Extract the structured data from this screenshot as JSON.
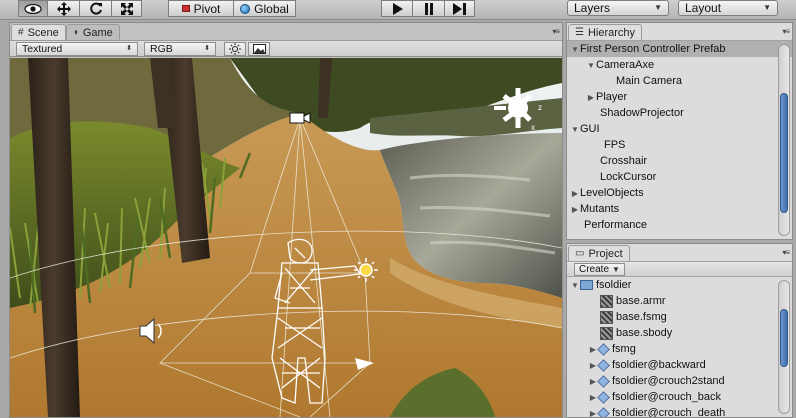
{
  "toolbar": {
    "tools": [
      "view-tool",
      "move-tool",
      "rotate-tool",
      "scale-tool"
    ],
    "pivot_label": "Pivot",
    "global_label": "Global",
    "play_controls": [
      "play",
      "pause",
      "step"
    ],
    "layers_label": "Layers",
    "layout_label": "Layout"
  },
  "scene_panel": {
    "tabs": [
      {
        "label": "Scene",
        "icon": "hash-icon"
      },
      {
        "label": "Game",
        "icon": "pacman-icon"
      }
    ],
    "render_mode": "Textured",
    "color_mode": "RGB"
  },
  "hierarchy": {
    "title": "Hierarchy",
    "items": [
      {
        "label": "First Person Controller Prefab",
        "level": 0,
        "expanded": true,
        "selected": true
      },
      {
        "label": "CameraAxe",
        "level": 1,
        "expanded": true
      },
      {
        "label": "Main Camera",
        "level": 2
      },
      {
        "label": "Player",
        "level": 1,
        "expanded": false
      },
      {
        "label": "ShadowProjector",
        "level": 1
      },
      {
        "label": "GUI",
        "level": 0,
        "expanded": true
      },
      {
        "label": "FPS",
        "level": 1
      },
      {
        "label": "Crosshair",
        "level": 1
      },
      {
        "label": "LockCursor",
        "level": 1
      },
      {
        "label": "LevelObjects",
        "level": 0,
        "expanded": false
      },
      {
        "label": "Mutants",
        "level": 0,
        "expanded": false
      },
      {
        "label": "Performance",
        "level": 0
      }
    ]
  },
  "project": {
    "title": "Project",
    "create_label": "Create",
    "items": [
      {
        "label": "fsoldier",
        "level": 0,
        "type": "folder",
        "expanded": true
      },
      {
        "label": "base.armr",
        "level": 1,
        "type": "mesh"
      },
      {
        "label": "base.fsmg",
        "level": 1,
        "type": "mesh"
      },
      {
        "label": "base.sbody",
        "level": 1,
        "type": "mesh"
      },
      {
        "label": "fsmg",
        "level": 1,
        "type": "prefab"
      },
      {
        "label": "fsoldier@backward",
        "level": 1,
        "type": "prefab"
      },
      {
        "label": "fsoldier@crouch2stand",
        "level": 1,
        "type": "prefab"
      },
      {
        "label": "fsoldier@crouch_back",
        "level": 1,
        "type": "prefab"
      },
      {
        "label": "fsoldier@crouch_death",
        "level": 1,
        "type": "prefab"
      }
    ]
  },
  "colors": {
    "selection": "#b0b0b0",
    "scrollbar_thumb": "#4a78b8",
    "panel_bg": "#dcdcdc"
  }
}
